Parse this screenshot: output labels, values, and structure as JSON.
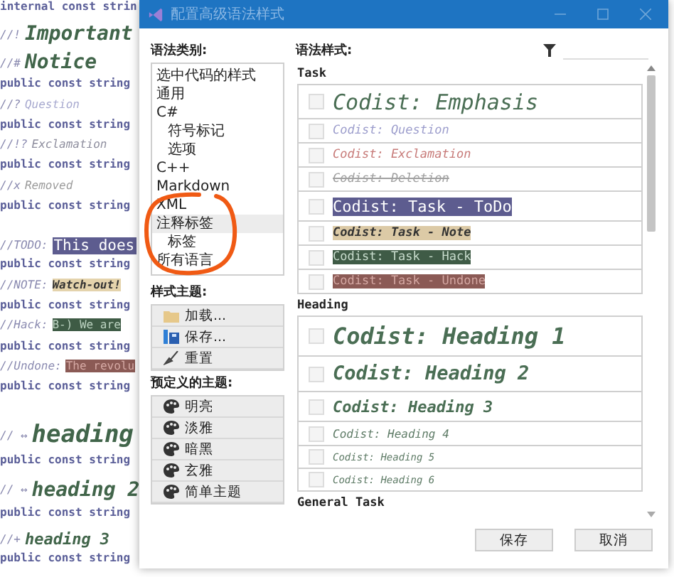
{
  "editor": {
    "lines": [
      {
        "kind": "code",
        "text": "internal const strin"
      },
      {
        "kind": "important",
        "prefix": "//!",
        "text": "Important"
      },
      {
        "kind": "notice",
        "prefix": "//#",
        "text": "Notice"
      },
      {
        "kind": "code",
        "text": "public const string"
      },
      {
        "kind": "question",
        "prefix": "//?",
        "text": "Question"
      },
      {
        "kind": "code",
        "text": "public const string"
      },
      {
        "kind": "exclamation",
        "prefix": "//!?",
        "text": "Exclamation"
      },
      {
        "kind": "code",
        "text": "public const string"
      },
      {
        "kind": "removed",
        "prefix": "//x",
        "text": "Removed"
      },
      {
        "kind": "code",
        "text": "public const string"
      },
      {
        "kind": "todo",
        "prefix": "//TODO:",
        "text": "This does"
      },
      {
        "kind": "code",
        "text": "public const string"
      },
      {
        "kind": "note",
        "prefix": "//NOTE:",
        "text": "Watch-out!"
      },
      {
        "kind": "code",
        "text": "public const string"
      },
      {
        "kind": "hack",
        "prefix": "//Hack:",
        "text": "B-) We are"
      },
      {
        "kind": "code",
        "text": "public const string"
      },
      {
        "kind": "undone",
        "prefix": "//Undone:",
        "text": "The revolu"
      },
      {
        "kind": "code",
        "text": "public const string"
      },
      {
        "kind": "heading1",
        "prefix": "// ↔",
        "text": "heading"
      },
      {
        "kind": "code",
        "text": "public const string"
      },
      {
        "kind": "heading2",
        "prefix": "// ↔",
        "text": "heading 2"
      },
      {
        "kind": "code",
        "text": "public const string"
      },
      {
        "kind": "heading3",
        "prefix": "//+",
        "text": "heading 3"
      },
      {
        "kind": "code",
        "text": "public const string"
      }
    ]
  },
  "window": {
    "title": "配置高级语法样式"
  },
  "categories": {
    "label": "语法类别:",
    "items": [
      {
        "label": "选中代码的样式",
        "selected": false
      },
      {
        "label": "通用",
        "selected": false
      },
      {
        "label": "C#",
        "selected": false,
        "children": [
          {
            "label": "符号标记",
            "selected": false
          },
          {
            "label": "选项",
            "selected": false
          }
        ]
      },
      {
        "label": "C++",
        "selected": false
      },
      {
        "label": "Markdown",
        "selected": false
      },
      {
        "label": "XML",
        "selected": false
      },
      {
        "label": "注释标签",
        "selected": true,
        "children": [
          {
            "label": "标签",
            "selected": false
          }
        ]
      },
      {
        "label": "所有语言",
        "selected": false
      }
    ]
  },
  "style_theme": {
    "label": "样式主题:",
    "buttons": [
      {
        "label": "加载...",
        "kind": "load"
      },
      {
        "label": "保存...",
        "kind": "save"
      },
      {
        "label": "重置",
        "kind": "reset"
      }
    ]
  },
  "predefined_themes": {
    "label": "预定义的主题:",
    "buttons": [
      "明亮",
      "淡雅",
      "暗黑",
      "玄雅",
      "简单主题"
    ]
  },
  "styles": {
    "label": "语法样式:",
    "groups": [
      {
        "title": "Task",
        "items": [
          {
            "label": "Codist: Emphasis",
            "kind": "emphasis",
            "checked": false
          },
          {
            "label": "Codist: Question",
            "kind": "question",
            "checked": false
          },
          {
            "label": "Codist: Exclamation",
            "kind": "exclamation",
            "checked": false
          },
          {
            "label": "Codist: Deletion",
            "kind": "deletion",
            "checked": false
          },
          {
            "label": "Codist: Task - ToDo",
            "kind": "todo",
            "checked": false
          },
          {
            "label": "Codist: Task - Note",
            "kind": "note",
            "checked": false
          },
          {
            "label": "Codist: Task - Hack",
            "kind": "hack",
            "checked": false
          },
          {
            "label": "Codist: Task - Undone",
            "kind": "undone",
            "checked": false
          }
        ]
      },
      {
        "title": "Heading",
        "items": [
          {
            "label": "Codist: Heading 1",
            "kind": "heading1",
            "checked": false
          },
          {
            "label": "Codist: Heading 2",
            "kind": "heading2",
            "checked": false
          },
          {
            "label": "Codist: Heading 3",
            "kind": "heading3",
            "checked": false
          },
          {
            "label": "Codist: Heading 4",
            "kind": "heading4",
            "checked": false
          },
          {
            "label": "Codist: Heading 5",
            "kind": "heading5",
            "checked": false
          },
          {
            "label": "Codist: Heading 6",
            "kind": "heading6",
            "checked": false
          }
        ]
      },
      {
        "title": "General Task"
      }
    ]
  },
  "buttons": [
    "保存",
    "取消"
  ]
}
